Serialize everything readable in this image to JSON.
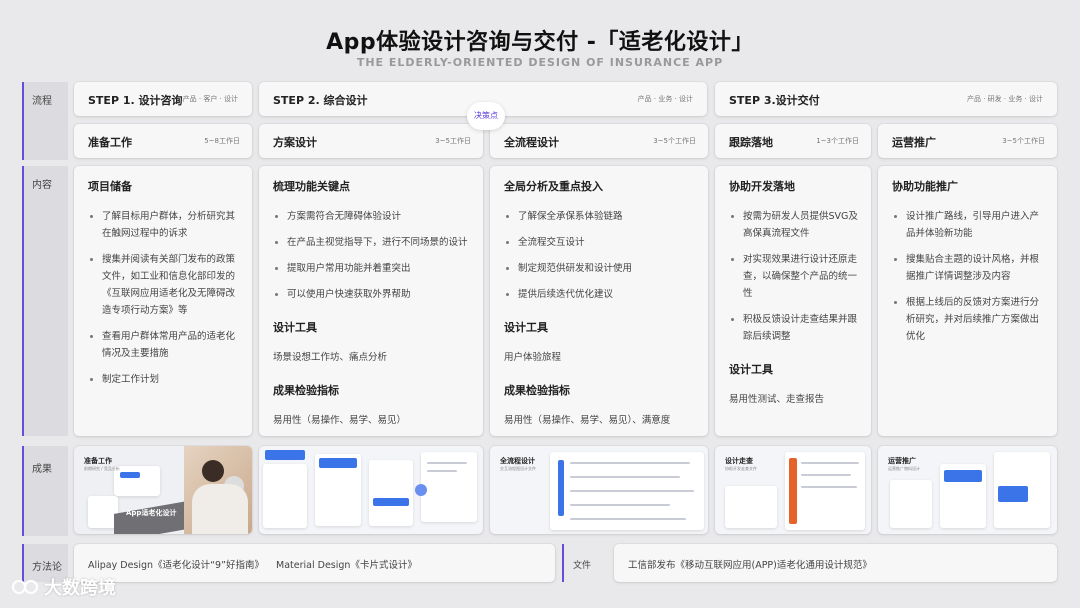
{
  "header": {
    "title": "App体验设计咨询与交付 -「适老化设计」",
    "subtitle": "THE ELDERLY-ORIENTED DESIGN OF INSURANCE APP"
  },
  "row_labels": {
    "process": "流程",
    "content": "内容",
    "result": "成果",
    "method": "方法论"
  },
  "steps": [
    {
      "title": "STEP 1. 设计咨询",
      "meta": "产品 · 客户 · 设计"
    },
    {
      "title": "STEP 2. 综合设计",
      "meta": "产品 · 业务 · 设计"
    },
    {
      "title": "STEP 3.设计交付",
      "meta": "产品 · 研发 · 业务 · 设计"
    }
  ],
  "decision_point": "决策点",
  "phases": [
    {
      "title": "准备工作",
      "time": "5~8工作日"
    },
    {
      "title": "方案设计",
      "time": "3~5工作日"
    },
    {
      "title": "全流程设计",
      "time": "3~5个工作日"
    },
    {
      "title": "跟踪落地",
      "time": "1~3个工作日"
    },
    {
      "title": "运营推广",
      "time": "3~5个工作日"
    }
  ],
  "content": [
    {
      "heading": "项目储备",
      "items": [
        "了解目标用户群体，分析研究其在触网过程中的诉求",
        "搜集并阅读有关部门发布的政策文件，如工业和信息化部印发的《互联网应用适老化及无障碍改造专项行动方案》等",
        "查看用户群体常用产品的适老化情况及主要措施",
        "制定工作计划"
      ]
    },
    {
      "heading": "梳理功能关键点",
      "items": [
        "方案需符合无障碍体验设计",
        "在产品主视觉指导下，进行不同场景的设计",
        "提取用户常用功能并着重突出",
        "可以使用户快速获取外界帮助"
      ],
      "tools_heading": "设计工具",
      "tools": "场景设想工作坊、痛点分析",
      "metrics_heading": "成果检验指标",
      "metrics": "易用性（易操作、易学、易见）"
    },
    {
      "heading": "全局分析及重点投入",
      "items": [
        "了解保全承保系体验链路",
        "全流程交互设计",
        "制定规范供研发和设计使用",
        "提供后续迭代优化建议"
      ],
      "tools_heading": "设计工具",
      "tools": "用户体验旅程",
      "metrics_heading": "成果检验指标",
      "metrics": "易用性（易操作、易学、易见）、满意度"
    },
    {
      "heading": "协助开发落地",
      "items": [
        "按需为研发人员提供SVG及高保真流程文件",
        "对实现效果进行设计还原走查，以确保整个产品的统一性",
        "积极反馈设计走查结果并跟踪后续调整"
      ],
      "tools_heading": "设计工具",
      "tools": "易用性测试、走查报告"
    },
    {
      "heading": "协助功能推广",
      "items": [
        "设计推广路线，引导用户进入产品并体验新功能",
        "搜集贴合主题的设计风格，并根据推广详情调整涉及内容",
        "根据上线后的反馈对方案进行分析研究，并对后续推广方案做出优化"
      ]
    }
  ],
  "results": [
    {
      "label": "准备工作",
      "sub": "前期研究 / 竞品分析"
    },
    {
      "label": "",
      "sub": ""
    },
    {
      "label": "全流程设计",
      "sub": "交互流程图设计文件"
    },
    {
      "label": "设计走查",
      "sub": "协助开发走查文件"
    },
    {
      "label": "运营推广",
      "sub": "运营推广物料设计"
    }
  ],
  "result_banner_text": "App适老化设计",
  "methodology": {
    "text": "Alipay Design《适老化设计“9”好指南》    Material Design《卡片式设计》",
    "file_label": "文件",
    "file_text": "工信部发布《移动互联网应用(APP)适老化通用设计规范》"
  },
  "watermark": "大数跨境",
  "colors": {
    "accent": "#6a4cdc",
    "background": "#e9e9eb",
    "card": "#f7f7f8",
    "blue": "#3a74e8"
  }
}
